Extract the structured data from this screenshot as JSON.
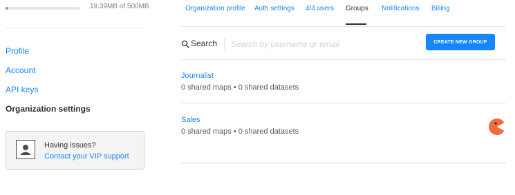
{
  "storage": {
    "used_text": "19.39MB of 500MB",
    "used_fraction": 0.039
  },
  "sidebar": {
    "items": [
      {
        "label": "Profile",
        "active": false
      },
      {
        "label": "Account",
        "active": false
      },
      {
        "label": "API keys",
        "active": false
      },
      {
        "label": "Organization settings",
        "active": true
      }
    ],
    "support": {
      "title": "Having issues?",
      "link": "Contact your VIP support"
    }
  },
  "tabs": [
    {
      "label": "Organization profile",
      "active": false
    },
    {
      "label": "Auth settings",
      "active": false
    },
    {
      "label": "4/4 users",
      "active": false
    },
    {
      "label": "Groups",
      "active": true
    },
    {
      "label": "Notifications",
      "active": false
    },
    {
      "label": "Billing",
      "active": false
    }
  ],
  "search": {
    "label": "Search",
    "placeholder": "Search by username or email"
  },
  "create_button": {
    "label": "CREATE NEW GROUP"
  },
  "groups": [
    {
      "name": "Journalist",
      "stats": "0 shared maps • 0 shared datasets"
    },
    {
      "name": "Sales",
      "stats": "0 shared maps • 0 shared datasets"
    }
  ],
  "colors": {
    "accent": "#1785fb",
    "text": "#333333",
    "muted": "#7f7f7f",
    "pacman": "#f36b3c"
  }
}
